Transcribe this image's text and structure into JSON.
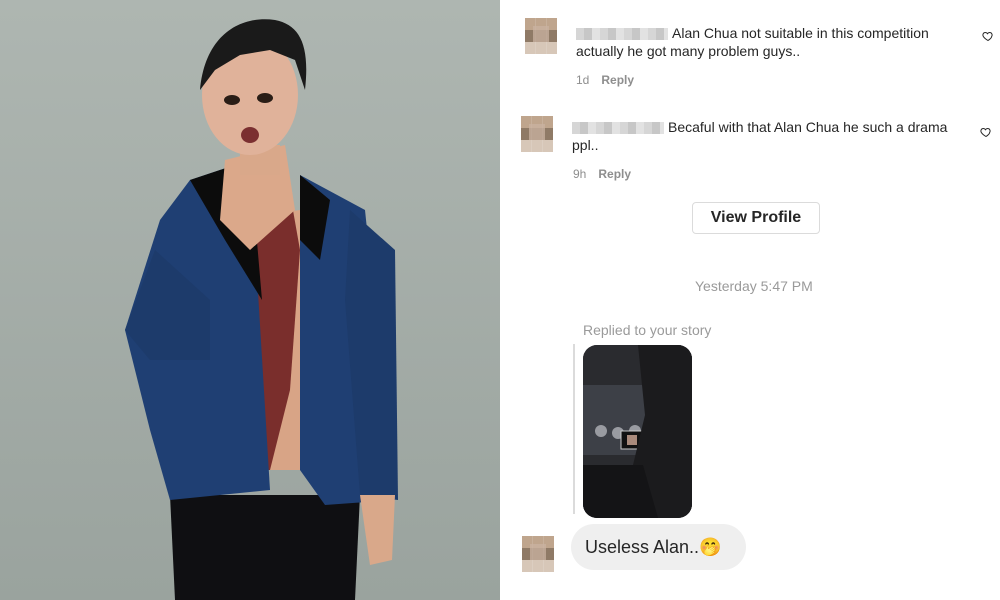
{
  "comments": [
    {
      "text_line1": "Alan Chua not suitable in this competition",
      "text_line2": "actually he got many problem guys..",
      "time": "1d",
      "reply_label": "Reply"
    },
    {
      "text_line1": "Becaful with that Alan Chua he such a drama",
      "text_line2": "ppl..",
      "time": "9h",
      "reply_label": "Reply"
    }
  ],
  "dm": {
    "view_profile_label": "View Profile",
    "timestamp": "Yesterday 5:47 PM",
    "replied_label": "Replied to your story",
    "message_text": "Useless Alan..",
    "message_emoji": "🤭"
  },
  "icons": {
    "heart": "heart-outline-icon",
    "avatar": "pixelated-avatar"
  },
  "colors": {
    "text_primary": "#262626",
    "text_secondary": "#8e8e8e",
    "bubble_bg": "#efefef",
    "jacket_blue": "#1f3f73",
    "photo_bg": "#a6aea9"
  }
}
